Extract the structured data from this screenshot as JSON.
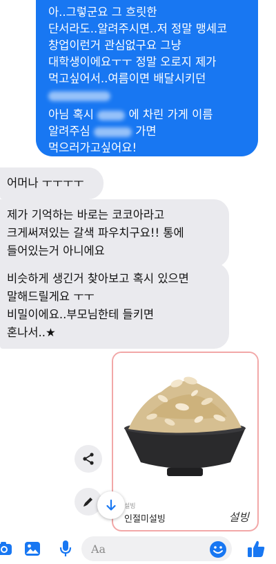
{
  "messages": {
    "outgoing": {
      "lines": [
        "아..그렇군요 그 흐릿한",
        "단서라도..알려주시면..저 정말 맹세코",
        "창업이런거 관심없구요 그냥",
        "대학생이에요ㅜㅜ 정말 오로지 제가",
        "먹고싶어서..여름이면 배달시키던",
        "",
        "아님 혹시 ",
        "에 차린 가게 이름",
        "알려주심 ",
        "가면",
        "먹으러가고싶어요!"
      ]
    },
    "incoming": [
      {
        "lines": [
          "어머나 ㅜㅜㅜㅜ"
        ]
      },
      {
        "lines": [
          "제가 기억하는 바로는 코코아라고",
          "크게써져있는 갈색 파우치구요!! 통에",
          "들어있는거 아니에요"
        ]
      },
      {
        "lines": [
          "비슷하게 생긴거 찾아보고 혹시 있으면",
          "말해드릴게요 ㅜㅜ",
          "비밀이에요..부모님한테 들키면",
          "혼나서..★"
        ]
      }
    ]
  },
  "card": {
    "subtitle": "설빙",
    "title": "인절미설빙",
    "logo": "설빙"
  },
  "composer": {
    "placeholder": "Aa"
  },
  "icons": {
    "accent": "#1877f2",
    "camera": "camera-icon",
    "gallery": "image-icon",
    "mic": "microphone-icon",
    "emoji": "emoji-icon",
    "like": "thumbs-up-icon",
    "share": "share-icon",
    "edit": "pencil-icon",
    "scroll": "arrow-down-icon"
  }
}
